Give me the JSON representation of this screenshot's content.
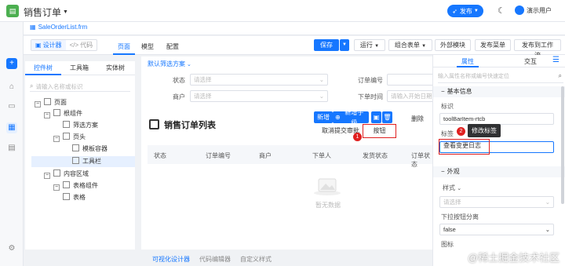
{
  "header": {
    "app_title": "销售订单",
    "publish_label": "发布",
    "user": "演示用户"
  },
  "file_tab": {
    "name": "SaleOrderList.frm"
  },
  "toolbar": {
    "designer": "设计器",
    "code": "代码",
    "tabs": [
      "页面",
      "模型",
      "配置"
    ],
    "save": "保存",
    "run": "运行",
    "combo": "组合表单",
    "external": "外部模块",
    "publish_menu": "发布菜单",
    "publish_flow": "发布到工作流"
  },
  "tree": {
    "tabs": [
      "控件树",
      "工具箱",
      "实体树"
    ],
    "search_placeholder": "请输入名称或标识",
    "items": [
      "页面",
      "根组件",
      "筛选方案",
      "页头",
      "模板容器",
      "工具栏",
      "内容区域",
      "表格组件",
      "表格"
    ]
  },
  "canvas": {
    "filter_scheme": "默认筛选方案",
    "status_label": "状态",
    "status_ph": "请选择",
    "order_no_label": "订单编号",
    "customer_label": "商户",
    "customer_ph": "请选择",
    "order_time_label": "下单时间",
    "order_time_ph": "请输入开始日期",
    "list_title": "销售订单列表",
    "new_btn": "新增",
    "new_child": "新增子级",
    "cancel_approve": "取消提交审批",
    "button_label": "按钮",
    "delete_label": "删除",
    "columns": [
      "状态",
      "订单编号",
      "商户",
      "下单人",
      "发货状态",
      "订单状态"
    ],
    "empty": "暂无数据"
  },
  "bottom_tabs": [
    "可视化设计器",
    "代码编辑器",
    "自定义样式"
  ],
  "props": {
    "tabs": [
      "属性",
      "交互"
    ],
    "search_placeholder": "输入属性名称或编号快速定位",
    "basic_section": "基本信息",
    "id_label": "标识",
    "id_value": "toolBarItem-rtcb",
    "label_label": "标签",
    "label_value": "查看变更日志",
    "tooltip": "修改标签",
    "appearance_section": "外观",
    "style_label": "样式",
    "style_ph": "请选择",
    "dropdown_split_label": "下拉按钮分离",
    "dropdown_split_value": "false",
    "icon_label": "图标"
  },
  "annotations": {
    "one": "1",
    "two": "2"
  },
  "watermark": "@稀土掘金技术社区",
  "colors": {
    "primary": "#1677ff",
    "annotation": "#e02020"
  }
}
